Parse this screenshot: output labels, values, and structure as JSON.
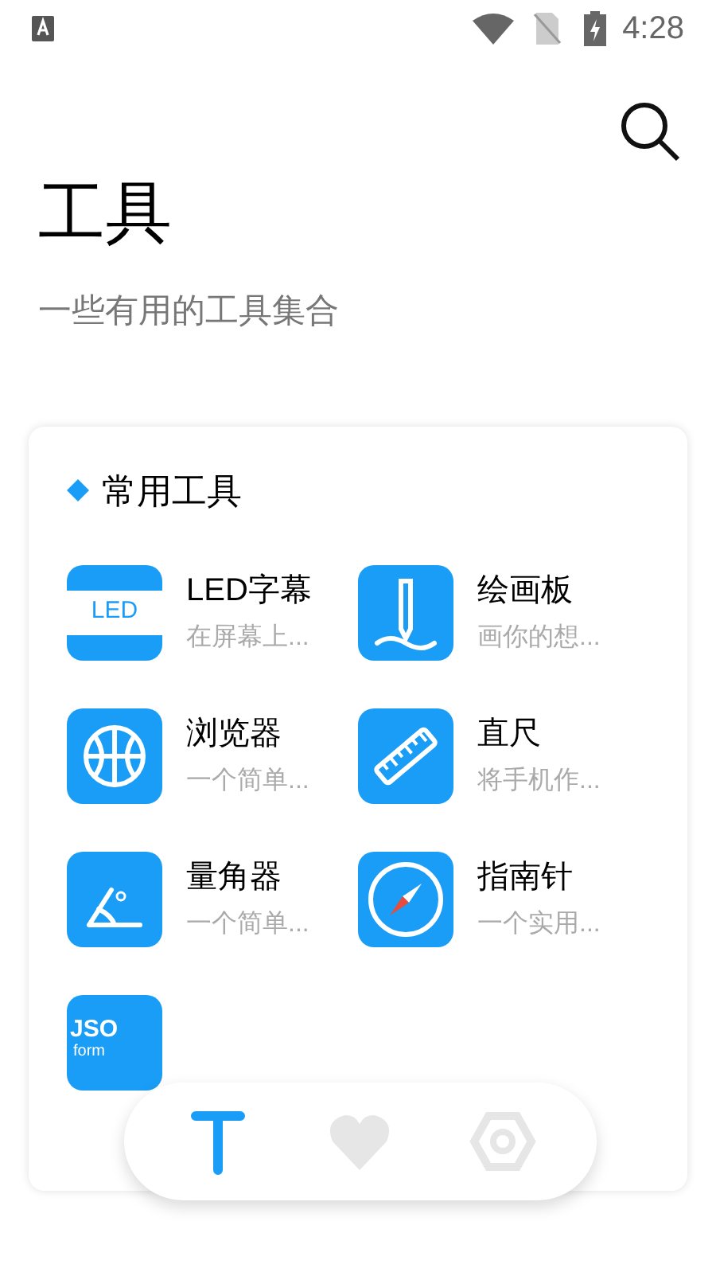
{
  "status_bar": {
    "time": "4:28"
  },
  "header": {
    "title": "工具",
    "subtitle": "一些有用的工具集合"
  },
  "section": {
    "title": "常用工具",
    "tools": [
      {
        "kind": "led",
        "name": "LED字幕",
        "description": "在屏幕上...",
        "icon_text": "LED"
      },
      {
        "kind": "draw",
        "name": "绘画板",
        "description": "画你的想..."
      },
      {
        "kind": "browser",
        "name": "浏览器",
        "description": "一个简单..."
      },
      {
        "kind": "ruler",
        "name": "直尺",
        "description": "将手机作..."
      },
      {
        "kind": "protractor",
        "name": "量角器",
        "description": "一个简单..."
      },
      {
        "kind": "compass",
        "name": "指南针",
        "description": "一个实用..."
      },
      {
        "kind": "json",
        "icon_text": "JSO",
        "icon_subtext": "form"
      }
    ]
  },
  "bottom_nav": [
    {
      "kind": "tools",
      "selected": true
    },
    {
      "kind": "favorites",
      "selected": false
    },
    {
      "kind": "settings",
      "selected": false
    }
  ]
}
